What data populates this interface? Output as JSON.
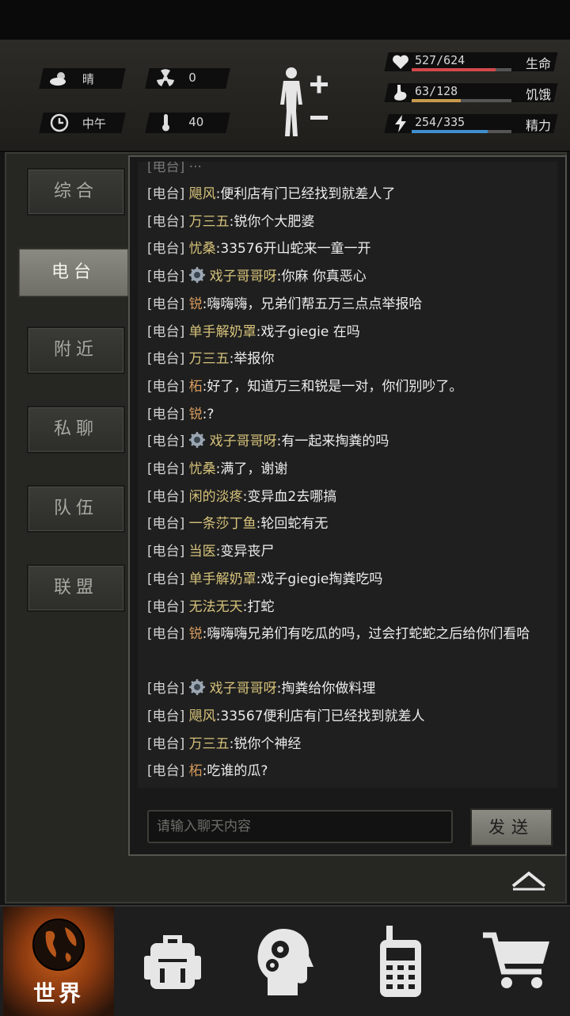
{
  "status": {
    "weather": {
      "icon": "cloud-sun-icon",
      "label": "晴"
    },
    "radiation": {
      "icon": "radiation-icon",
      "value": "0"
    },
    "time": {
      "icon": "clock-icon",
      "label": "中午"
    },
    "temperature": {
      "icon": "thermometer-icon",
      "value": "40"
    }
  },
  "character_button": {
    "icon": "body-plus-minus-icon"
  },
  "stats": [
    {
      "icon": "heart-icon",
      "value": "527/624",
      "label": "生命",
      "fraction": 0.845,
      "color": "#d2494b"
    },
    {
      "icon": "stomach-icon",
      "value": "63/128",
      "label": "饥饿",
      "fraction": 0.49,
      "color": "#c69a4c"
    },
    {
      "icon": "energy-icon",
      "value": "254/335",
      "label": "精力",
      "fraction": 0.758,
      "color": "#3f8fcf"
    }
  ],
  "tabs": [
    {
      "label": "综合",
      "active": false
    },
    {
      "label": "电台",
      "active": true
    },
    {
      "label": "附近",
      "active": false
    },
    {
      "label": "私聊",
      "active": false
    },
    {
      "label": "队伍",
      "active": false
    },
    {
      "label": "联盟",
      "active": false
    }
  ],
  "chat": {
    "channel_tag": "[电台]",
    "messages": [
      {
        "name": "飓风",
        "text": ":便利店有门已经找到就差人了"
      },
      {
        "name": "万三五",
        "text": ":锐你个大肥婆"
      },
      {
        "name": "忧桑",
        "text": ":33576开山蛇来一童一开"
      },
      {
        "name": "戏子哥哥呀",
        "badge": true,
        "text": ":你麻 你真恶心"
      },
      {
        "name": "锐",
        "text": ":嗨嗨嗨，兄弟们帮五万三点点举报哈"
      },
      {
        "name": "单手解奶罩",
        "text": ":戏子giegie 在吗"
      },
      {
        "name": "万三五",
        "text": ":举报你"
      },
      {
        "name": "柘",
        "text": ":好了，知道万三和锐是一对，你们别吵了。"
      },
      {
        "name": "锐",
        "text": ":?"
      },
      {
        "name": "戏子哥哥呀",
        "badge": true,
        "text": ":有一起来掏粪的吗"
      },
      {
        "name": "忧桑",
        "text": ":满了，谢谢"
      },
      {
        "name": "闲的淡疼",
        "text": ":变异血2去哪搞"
      },
      {
        "name": "一条莎丁鱼",
        "text": ":轮回蛇有无"
      },
      {
        "name": "当医",
        "text": ":变异丧尸"
      },
      {
        "name": "单手解奶罩",
        "text": ":戏子giegie掏粪吃吗"
      },
      {
        "name": "无法无天",
        "text": ":打蛇"
      },
      {
        "name": "锐",
        "text": ":嗨嗨嗨兄弟们有吃瓜的吗，过会打蛇蛇之后给你们看哈"
      },
      {
        "name": "戏子哥哥呀",
        "badge": true,
        "text": ":掏粪给你做料理"
      },
      {
        "name": "飓风",
        "text": ":33567便利店有门已经找到就差人"
      },
      {
        "name": "万三五",
        "text": ":锐你个神经"
      },
      {
        "name": "柘",
        "text": ":吃谁的瓜?"
      }
    ],
    "input_placeholder": "请输入聊天内容",
    "send_label": "发送"
  },
  "bottom_nav": [
    {
      "icon": "globe-icon",
      "label": "世界",
      "active": true
    },
    {
      "icon": "backpack-icon",
      "label": "",
      "active": false
    },
    {
      "icon": "head-gears-icon",
      "label": "",
      "active": false
    },
    {
      "icon": "walkie-talkie-icon",
      "label": "",
      "active": false
    },
    {
      "icon": "cart-icon",
      "label": "",
      "active": false
    }
  ]
}
